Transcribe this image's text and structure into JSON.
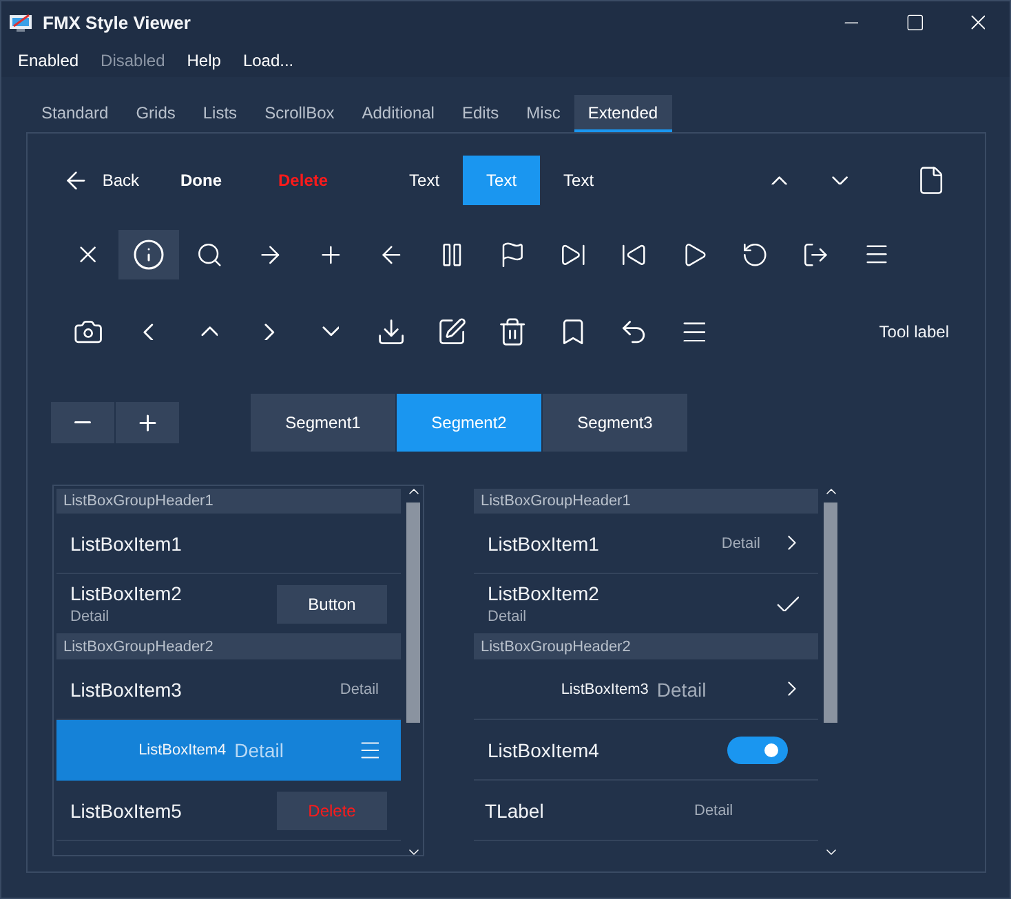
{
  "window": {
    "title": "FMX Style Viewer"
  },
  "menu": [
    {
      "label": "Enabled",
      "disabled": false
    },
    {
      "label": "Disabled",
      "disabled": true
    },
    {
      "label": "Help",
      "disabled": false
    },
    {
      "label": "Load...",
      "disabled": false
    }
  ],
  "tabs": [
    {
      "label": "Standard",
      "selected": false
    },
    {
      "label": "Grids",
      "selected": false
    },
    {
      "label": "Lists",
      "selected": false
    },
    {
      "label": "ScrollBox",
      "selected": false
    },
    {
      "label": "Additional",
      "selected": false
    },
    {
      "label": "Edits",
      "selected": false
    },
    {
      "label": "Misc",
      "selected": false
    },
    {
      "label": "Extended",
      "selected": true
    }
  ],
  "nav_bar": {
    "back": "Back",
    "done": "Done",
    "delete": "Delete",
    "segments": [
      {
        "label": "Text",
        "selected": false
      },
      {
        "label": "Text",
        "selected": true
      },
      {
        "label": "Text",
        "selected": false
      }
    ]
  },
  "tool_row_1": [
    {
      "selected": false
    },
    {
      "selected": true
    },
    {
      "selected": false
    },
    {
      "selected": false
    },
    {
      "selected": false
    },
    {
      "selected": false
    },
    {
      "selected": false
    },
    {
      "selected": false
    },
    {
      "selected": false
    },
    {
      "selected": false
    },
    {
      "selected": false
    },
    {
      "selected": false
    },
    {
      "selected": false
    },
    {
      "selected": false
    }
  ],
  "tool_row_2": {
    "tool_label": "Tool label"
  },
  "segmented_control": [
    {
      "label": "Segment1",
      "selected": false
    },
    {
      "label": "Segment2",
      "selected": true
    },
    {
      "label": "Segment3",
      "selected": false
    }
  ],
  "list_left": [
    {
      "kind": "header",
      "text": "ListBoxGroupHeader1"
    },
    {
      "kind": "plain",
      "text": "ListBoxItem1",
      "selected": false
    },
    {
      "kind": "subtitle-button",
      "text": "ListBoxItem2",
      "detail": "Detail",
      "button": "Button",
      "selected": false
    },
    {
      "kind": "header",
      "text": "ListBoxGroupHeader2"
    },
    {
      "kind": "right-detail",
      "text": "ListBoxItem3",
      "detail": "Detail",
      "selected": false
    },
    {
      "kind": "inline-detail-menu",
      "text": "ListBoxItem4",
      "detail": "Detail",
      "selected": true
    },
    {
      "kind": "delete",
      "text": "ListBoxItem5",
      "button": "Delete",
      "selected": false
    }
  ],
  "list_right": [
    {
      "kind": "header",
      "text": "ListBoxGroupHeader1"
    },
    {
      "kind": "right-detail-chevron",
      "text": "ListBoxItem1",
      "detail": "Detail",
      "selected": false
    },
    {
      "kind": "subtitle-check",
      "text": "ListBoxItem2",
      "detail": "Detail",
      "selected": false
    },
    {
      "kind": "header",
      "text": "ListBoxGroupHeader2"
    },
    {
      "kind": "inline-detail-chevron",
      "text": "ListBoxItem3",
      "detail": "Detail",
      "selected": false
    },
    {
      "kind": "switch",
      "text": "ListBoxItem4",
      "on": true,
      "selected": false
    },
    {
      "kind": "label-detail",
      "text": "TLabel",
      "detail": "Detail",
      "selected": false
    }
  ]
}
